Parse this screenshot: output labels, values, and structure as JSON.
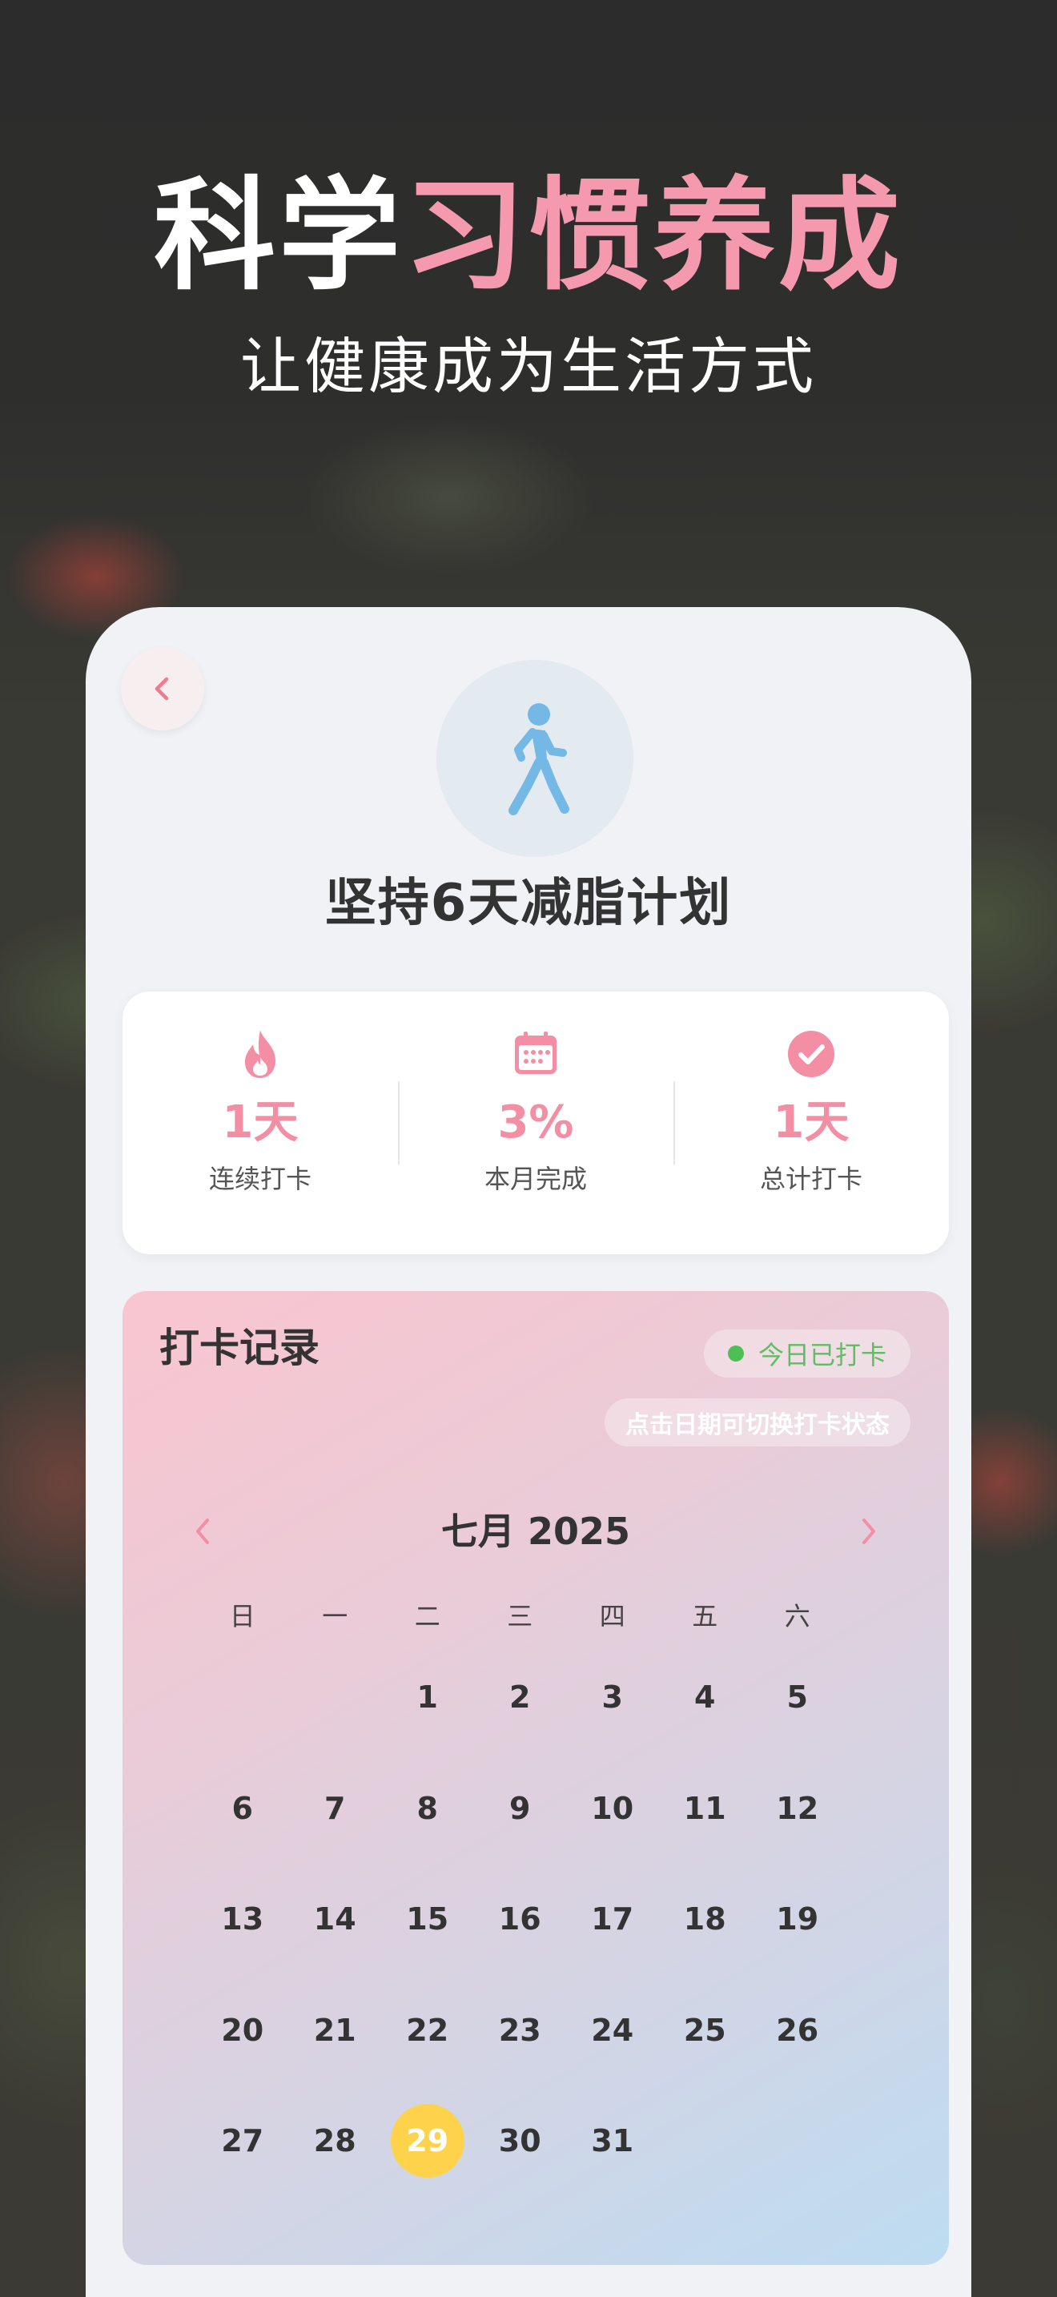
{
  "hero": {
    "title_main": "科学",
    "title_accent": "习惯养成",
    "subtitle": "让健康成为生活方式"
  },
  "plan": {
    "icon": "walking-person-icon",
    "title": "坚持6天减脂计划"
  },
  "stats": [
    {
      "icon": "flame-icon",
      "value": "1天",
      "label": "连续打卡"
    },
    {
      "icon": "calendar-icon",
      "value": "3%",
      "label": "本月完成"
    },
    {
      "icon": "check-circle-icon",
      "value": "1天",
      "label": "总计打卡"
    }
  ],
  "calendar": {
    "title": "打卡记录",
    "status_badge": "今日已打卡",
    "hint": "点击日期可切换打卡状态",
    "month_label": "七月 2025",
    "weekdays": [
      "日",
      "一",
      "二",
      "三",
      "四",
      "五",
      "六"
    ],
    "days": [
      [
        "",
        "",
        "1",
        "2",
        "3",
        "4",
        "5"
      ],
      [
        "6",
        "7",
        "8",
        "9",
        "10",
        "11",
        "12"
      ],
      [
        "13",
        "14",
        "15",
        "16",
        "17",
        "18",
        "19"
      ],
      [
        "20",
        "21",
        "22",
        "23",
        "24",
        "25",
        "26"
      ],
      [
        "27",
        "28",
        "29",
        "30",
        "31",
        "",
        ""
      ]
    ],
    "today": "29"
  },
  "colors": {
    "accent_pink": "#f48ea4",
    "today_highlight": "#ffd24b",
    "checked_green": "#4cbf55",
    "walker_blue": "#74b8e6"
  }
}
